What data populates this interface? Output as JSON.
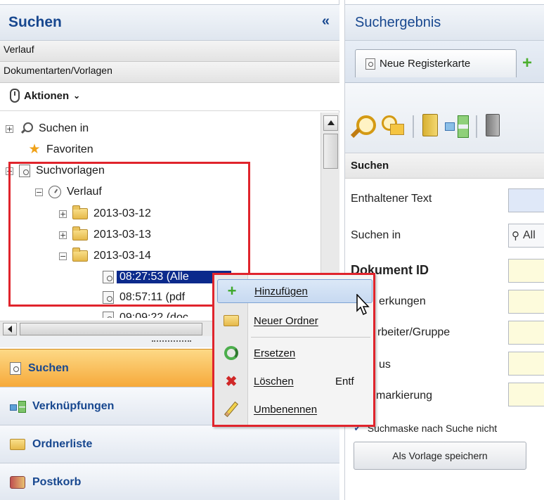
{
  "left_panel": {
    "title": "Suchen",
    "collapse_glyph": "«",
    "accordion": [
      "Verlauf",
      "Dokumentarten/Vorlagen"
    ],
    "actions_label": "Aktionen",
    "tree": {
      "suchen_in": "Suchen in",
      "favoriten": "Favoriten",
      "suchvorlagen": "Suchvorlagen",
      "verlauf": "Verlauf",
      "dates": [
        "2013-03-12",
        "2013-03-13",
        "2013-03-14"
      ],
      "entries": [
        "08:27:53 (Alle",
        "08:57:11 (pdf",
        "09:09:22 (doc"
      ]
    },
    "nav": [
      "Suchen",
      "Verknüpfungen",
      "Ordnerliste",
      "Postkorb"
    ]
  },
  "right_panel": {
    "title": "Suchergebnis",
    "tab_label": "Neue Registerkarte",
    "section_title": "Suchen",
    "form": {
      "enthaltener_text": "Enthaltener Text",
      "suchen_in": "Suchen in",
      "suchen_in_value": "All",
      "dokument_id": "Dokument ID",
      "bemerkungen": "erkungen",
      "bearbeiter": "rbeiter/Gruppe",
      "status": "us",
      "markierung": "markierung"
    },
    "checkbox_label": "Suchmaske nach Suche nicht",
    "save_template_label": "Als Vorlage speichern"
  },
  "context_menu": {
    "items": [
      {
        "label": "Hinzufügen",
        "shortcut": ""
      },
      {
        "label": "Neuer Ordner",
        "shortcut": ""
      },
      {
        "label": "Ersetzen",
        "shortcut": ""
      },
      {
        "label": "Löschen",
        "shortcut": "Entf"
      },
      {
        "label": "Umbenennen",
        "shortcut": ""
      }
    ],
    "highlighted": "Hinzufügen"
  },
  "colors": {
    "accent_blue": "#17478f",
    "highlight_red": "#e0242c",
    "active_nav_orange": "#f6a93a",
    "selection_navy": "#0b2a8c"
  },
  "icons": [
    "expand-icon",
    "search-icon",
    "star-icon",
    "clock-icon",
    "folder-icon",
    "document-search-icon",
    "plus-icon",
    "recycle-icon",
    "delete-x-icon",
    "pencil-icon",
    "mouse-icon",
    "cursor-icon"
  ]
}
